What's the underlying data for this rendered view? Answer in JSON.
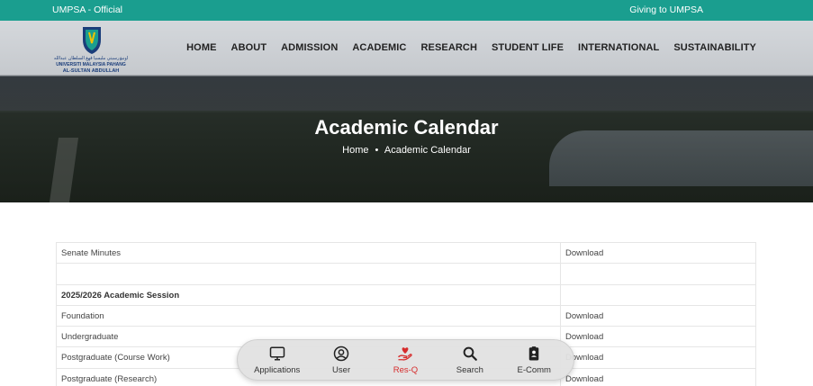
{
  "topbar": {
    "left_text": "UMPSA - Official",
    "right_text": "Giving to UMPSA"
  },
  "logo": {
    "line_arabic": "اونيۏرسيتي مليسيا ڤهڠ السلطان عبدالله",
    "line1": "UNIVERSITI MALAYSIA PAHANG",
    "line2": "AL-SULTAN ABDULLAH"
  },
  "nav": {
    "items": [
      "HOME",
      "ABOUT",
      "ADMISSION",
      "ACADEMIC",
      "RESEARCH",
      "STUDENT LIFE",
      "INTERNATIONAL",
      "SUSTAINABILITY"
    ]
  },
  "hero": {
    "title": "Academic Calendar",
    "breadcrumb_home": "Home",
    "breadcrumb_sep": "•",
    "breadcrumb_current": "Academic Calendar"
  },
  "table": {
    "rows": [
      {
        "label": "Senate Minutes",
        "action": "Download",
        "bold": false
      },
      {
        "label": "",
        "action": "",
        "bold": false
      },
      {
        "label": "2025/2026 Academic Session",
        "action": "",
        "bold": true
      },
      {
        "label": "Foundation",
        "action": "Download",
        "bold": false
      },
      {
        "label": "Undergraduate",
        "action": "Download",
        "bold": false
      },
      {
        "label": "Postgraduate (Course Work)",
        "action": "Download",
        "bold": false
      },
      {
        "label": "Postgraduate (Research)",
        "action": "Download",
        "bold": false
      }
    ]
  },
  "dock": {
    "items": [
      {
        "label": "Applications",
        "icon": "monitor-icon"
      },
      {
        "label": "User",
        "icon": "user-circle-icon"
      },
      {
        "label": "Res-Q",
        "icon": "heart-hand-icon"
      },
      {
        "label": "Search",
        "icon": "search-icon"
      },
      {
        "label": "E-Comm",
        "icon": "badge-icon"
      }
    ],
    "active_color": "#d62b2b"
  },
  "colors": {
    "topbar": "#1a9e8f",
    "text": "#333333"
  }
}
